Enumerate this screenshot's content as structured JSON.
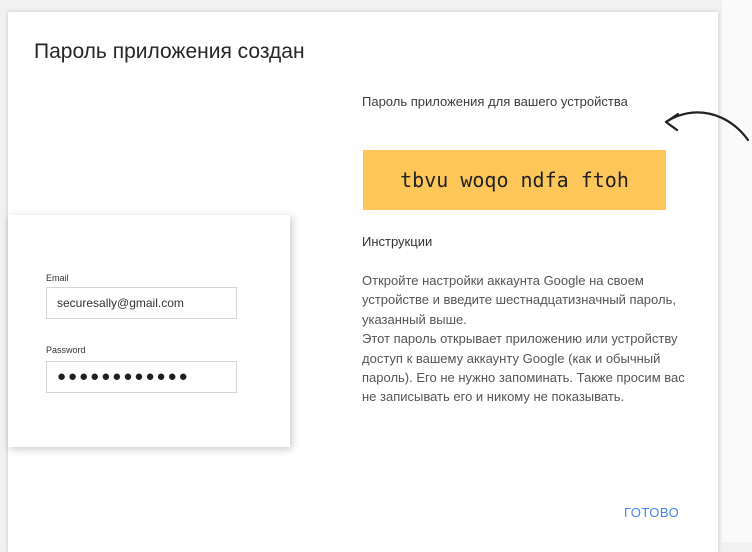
{
  "dialog": {
    "title": "Пароль приложения создан",
    "password_caption": "Пароль приложения для вашего устройства",
    "password_value": "tbvu woqo ndfa ftoh",
    "instructions_heading": "Инструкции",
    "instructions_paragraph_1": "Откройте настройки аккаунта Google на своем устройстве и введите шестнадцатизначный пароль, указанный выше.",
    "instructions_paragraph_2": "Этот пароль открывает приложению или устройству доступ к вашему аккаунту Google (как и обычный пароль). Его не нужно запоминать. Также просим вас не записывать его и никому не показывать.",
    "done_label": "ГОТОВО"
  },
  "login_card": {
    "email_label": "Email",
    "email_value": "securesally@gmail.com",
    "password_label": "Password",
    "password_value": "●●●●●●●●●●●●"
  },
  "colors": {
    "password_highlight": "#fcc758",
    "link_blue": "#4285f4"
  },
  "icons": {
    "arrow": "curved-arrow-icon"
  }
}
